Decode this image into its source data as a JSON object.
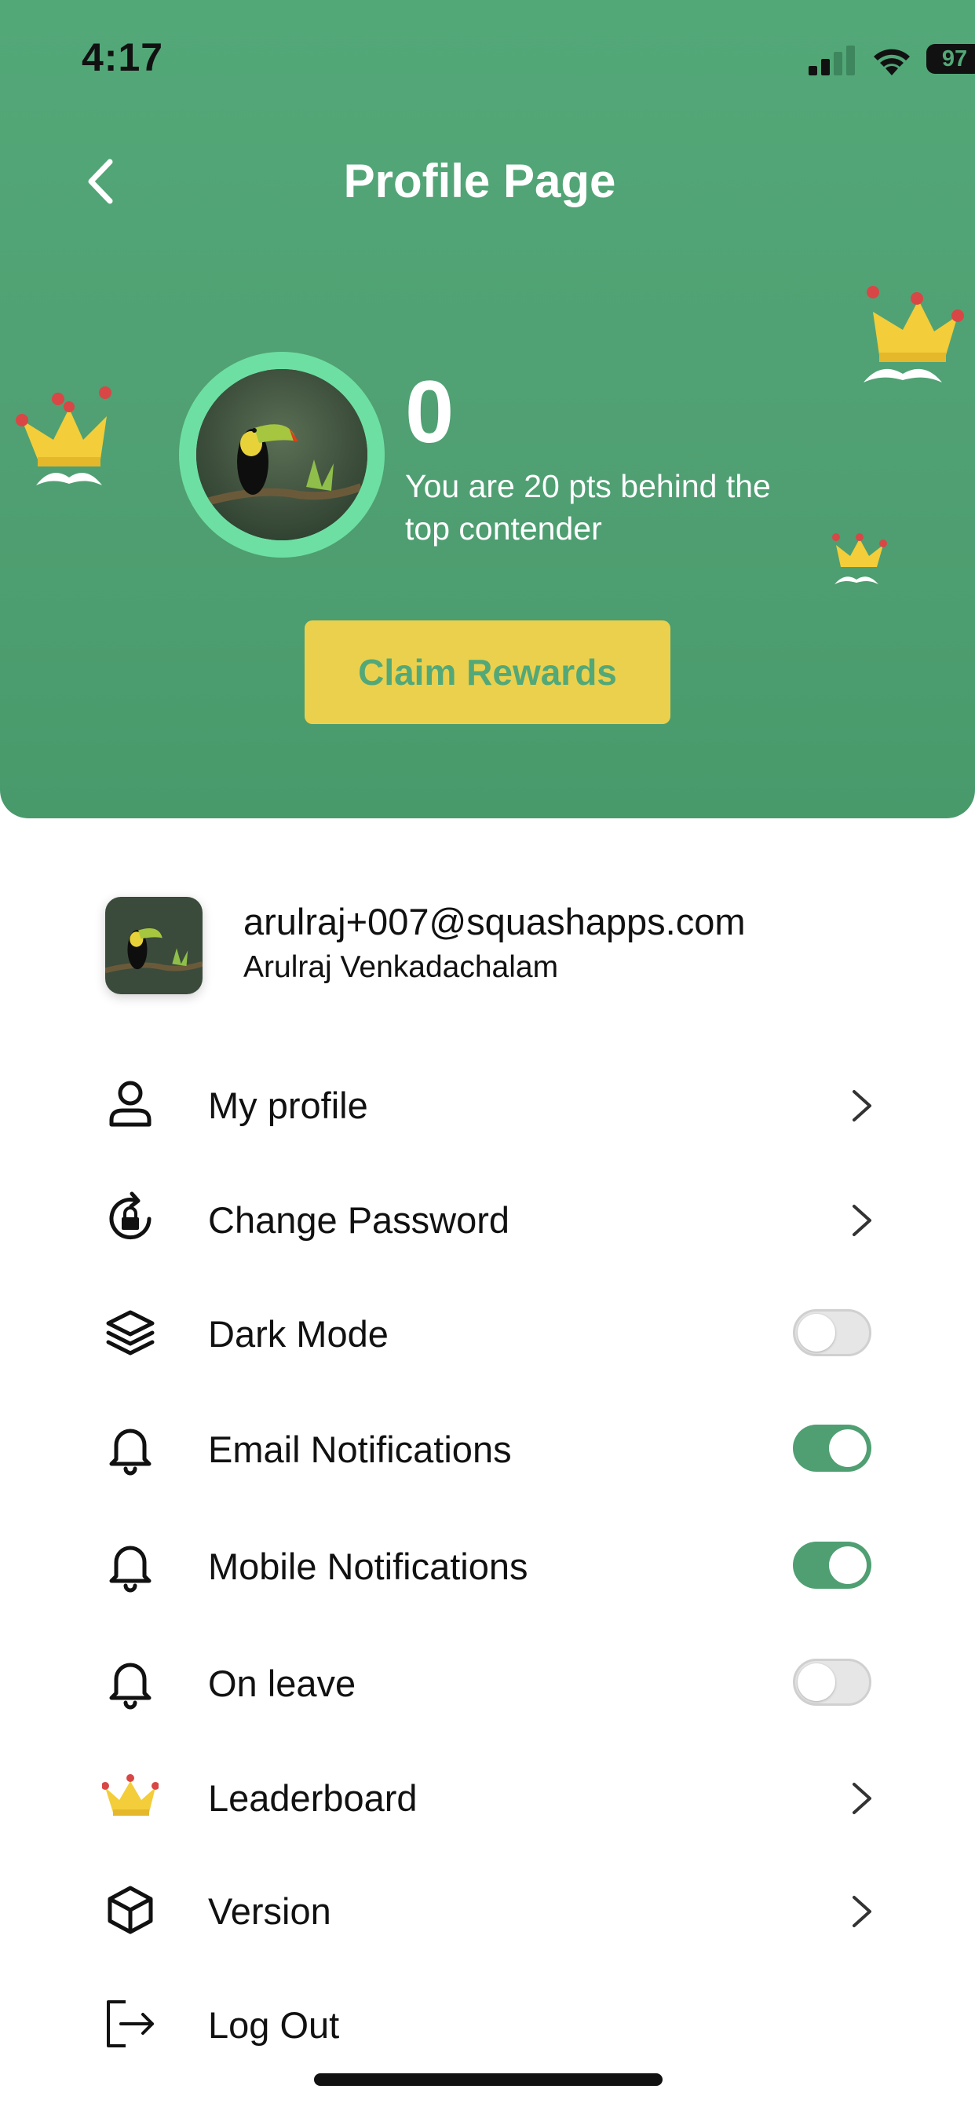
{
  "status_bar": {
    "time": "4:17",
    "battery": "97"
  },
  "header": {
    "title": "Profile Page",
    "back_icon": "chevron-left-icon"
  },
  "score": {
    "points": "0",
    "message": "You are 20 pts behind the top contender"
  },
  "claim_button": {
    "label": "Claim Rewards"
  },
  "account": {
    "email": "arulraj+007@squashapps.com",
    "name": "Arulraj Venkadachalam"
  },
  "menu": [
    {
      "label": "My profile",
      "icon": "user-icon",
      "control": "chevron"
    },
    {
      "label": "Change Password",
      "icon": "lock-refresh-icon",
      "control": "chevron"
    },
    {
      "label": "Dark Mode",
      "icon": "layers-icon",
      "control": "toggle",
      "enabled": false
    },
    {
      "label": "Email Notifications",
      "icon": "bell-icon",
      "control": "toggle",
      "enabled": true
    },
    {
      "label": "Mobile Notifications",
      "icon": "bell-icon",
      "control": "toggle",
      "enabled": true
    },
    {
      "label": "On leave",
      "icon": "bell-icon",
      "control": "toggle",
      "enabled": false
    },
    {
      "label": "Leaderboard",
      "icon": "crown-icon",
      "control": "chevron"
    },
    {
      "label": "Version",
      "icon": "cube-icon",
      "control": "chevron"
    },
    {
      "label": "Log Out",
      "icon": "logout-icon",
      "control": "none"
    }
  ],
  "colors": {
    "primary_green": "#53a878",
    "ring_green": "#6edfa2",
    "button_yellow": "#ebd04d",
    "toggle_on": "#4f9f72",
    "toggle_off": "#e6e6e6"
  }
}
